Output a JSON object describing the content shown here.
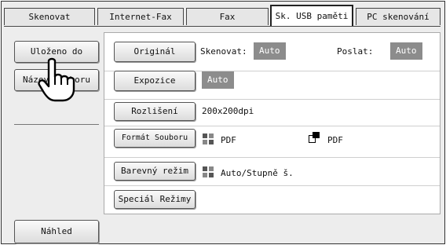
{
  "tabs": [
    {
      "label": "Skenovat",
      "active": false
    },
    {
      "label": "Internet-Fax",
      "active": false
    },
    {
      "label": "Fax",
      "active": false
    },
    {
      "label": "Sk. USB paměti",
      "active": true
    },
    {
      "label": "PC skenování",
      "active": false
    }
  ],
  "left": {
    "save_label": "Uloženo do",
    "filename_label": "Název souboru",
    "preview_label": "Náhled"
  },
  "settings": {
    "original": {
      "button": "Originál",
      "scan_label": "Skenovat:",
      "scan_value": "Auto",
      "send_label": "Poslat:",
      "send_value": "Auto"
    },
    "exposure": {
      "button": "Expozice",
      "value": "Auto"
    },
    "resolution": {
      "button": "Rozlišení",
      "value": "200x200dpi"
    },
    "format": {
      "button": "Formát Souboru",
      "color_value": "PDF",
      "bw_value": "PDF"
    },
    "colormode": {
      "button": "Barevný režim",
      "value": "Auto/Stupně š."
    },
    "special": {
      "button": "Speciál Režimy"
    }
  },
  "colors": {
    "badge": "#8c8c8c",
    "frame": "#ededed"
  }
}
